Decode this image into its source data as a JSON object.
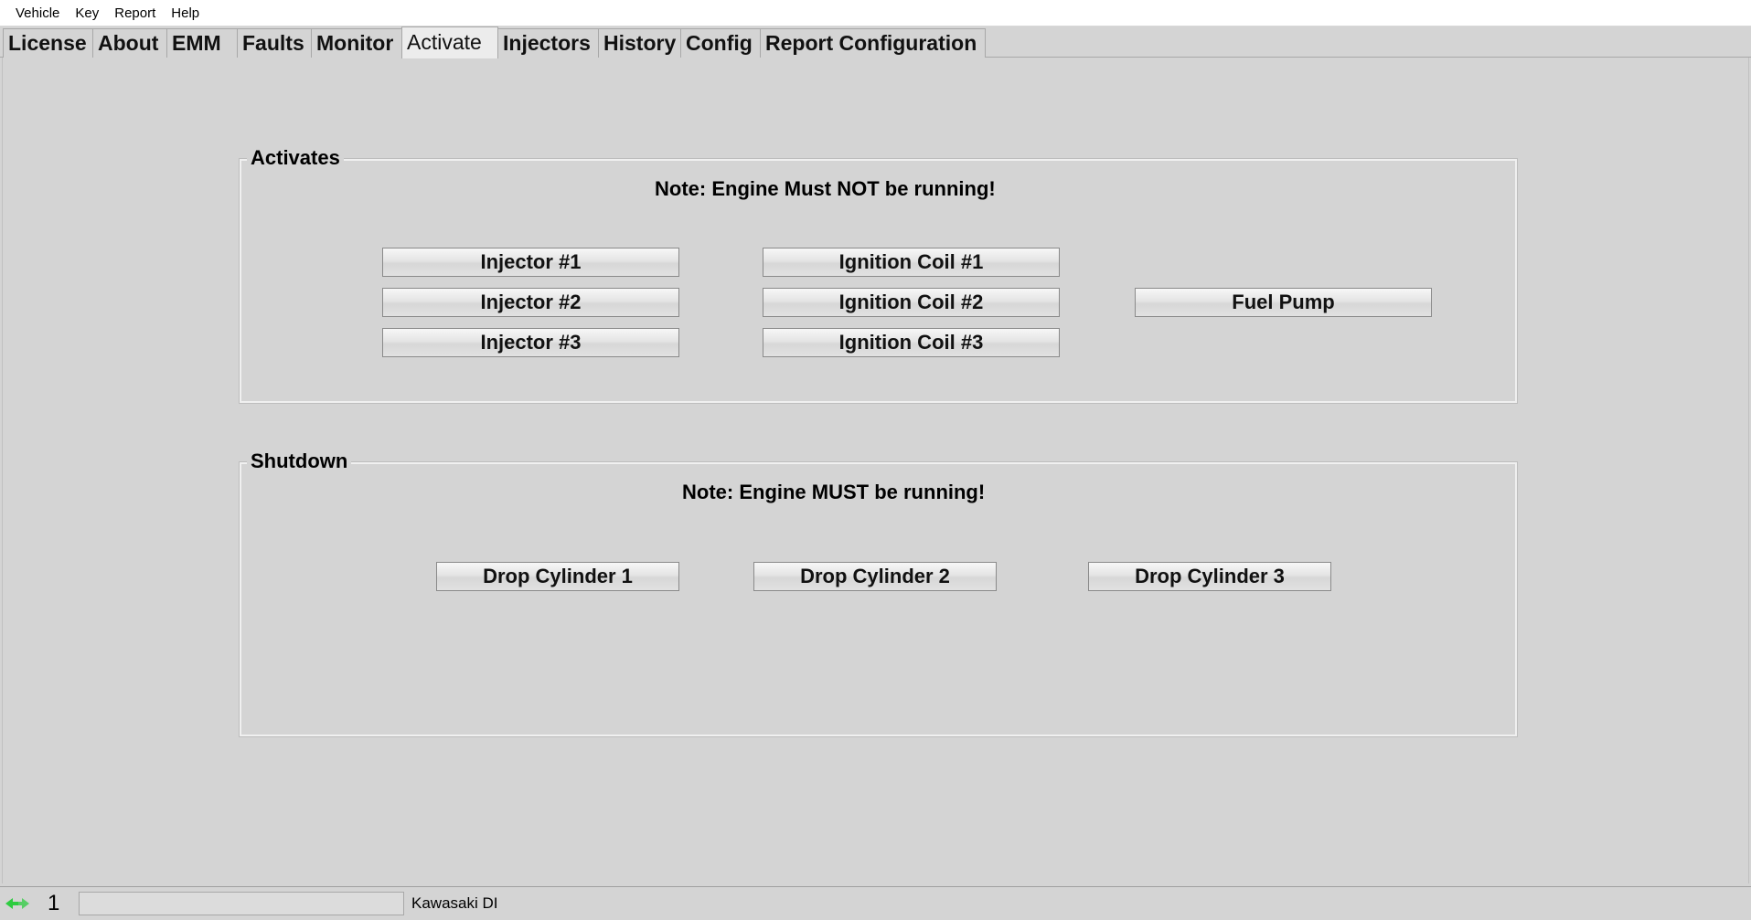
{
  "menubar": {
    "items": [
      "Vehicle",
      "Key",
      "Report",
      "Help"
    ]
  },
  "tabs": {
    "items": [
      "License",
      "About",
      "EMM",
      "Faults",
      "Monitor",
      "Activate",
      "Injectors",
      "History",
      "Config",
      "Report Configuration"
    ],
    "active": "Activate"
  },
  "activates": {
    "title": "Activates",
    "note": "Note: Engine Must NOT be running!",
    "injector_1": "Injector #1",
    "injector_2": "Injector #2",
    "injector_3": "Injector #3",
    "coil_1": "Ignition Coil #1",
    "coil_2": "Ignition Coil #2",
    "coil_3": "Ignition Coil #3",
    "fuel_pump": "Fuel Pump"
  },
  "shutdown": {
    "title": "Shutdown",
    "note": "Note: Engine MUST be running!",
    "drop_1": "Drop Cylinder 1",
    "drop_2": "Drop Cylinder 2",
    "drop_3": "Drop Cylinder 3"
  },
  "statusbar": {
    "icon": "connection-icon",
    "icon_color": "#2ecc40",
    "count": "1",
    "progress_fraction": 0,
    "vehicle": "Kawasaki DI"
  }
}
